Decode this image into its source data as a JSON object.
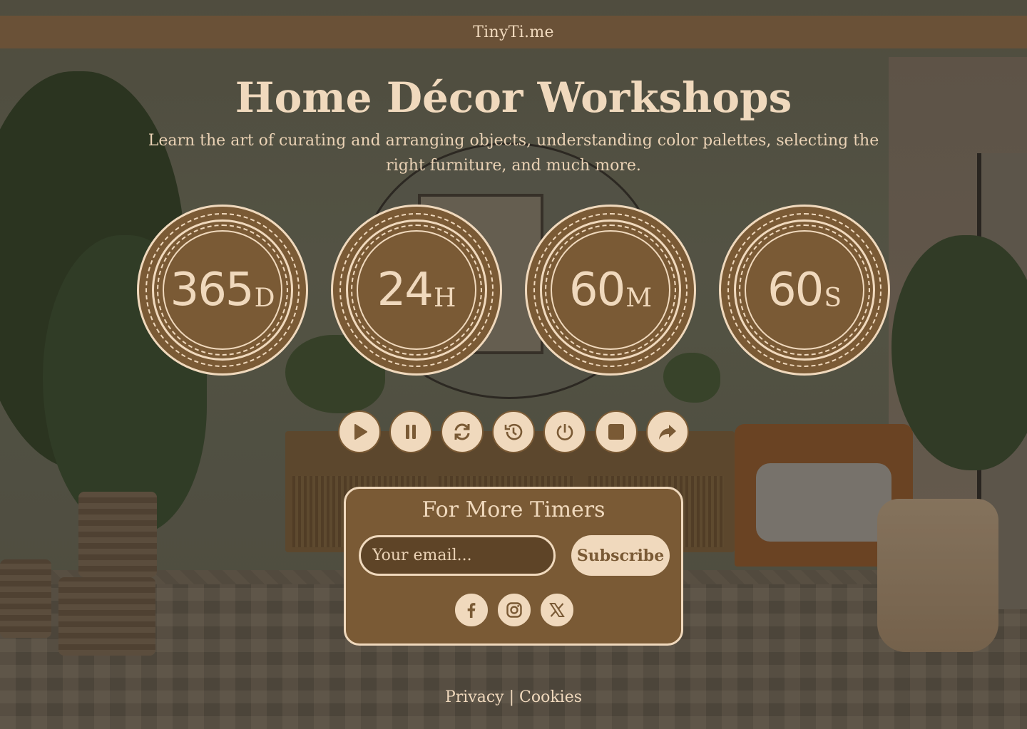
{
  "header": {
    "brand": "TinyTi.me"
  },
  "hero": {
    "title": "Home Décor Workshops",
    "subtitle": "Learn the art of curating and arranging objects, understanding color palettes, selecting the right furniture, and much more."
  },
  "timers": [
    {
      "value": "365",
      "unit": "D"
    },
    {
      "value": "24",
      "unit": "H"
    },
    {
      "value": "60",
      "unit": "M"
    },
    {
      "value": "60",
      "unit": "S"
    }
  ],
  "controls": [
    {
      "icon": "play-icon"
    },
    {
      "icon": "pause-icon"
    },
    {
      "icon": "refresh-icon"
    },
    {
      "icon": "history-icon"
    },
    {
      "icon": "power-icon"
    },
    {
      "icon": "stop-icon"
    },
    {
      "icon": "share-icon"
    }
  ],
  "subscribe": {
    "title": "For More Timers",
    "email_placeholder": "Your email...",
    "button_label": "Subscribe",
    "social": [
      "facebook-icon",
      "instagram-icon",
      "x-icon"
    ]
  },
  "footer": {
    "privacy": "Privacy",
    "separator": "|",
    "cookies": "Cookies"
  },
  "colors": {
    "accent": "#f0d9bd",
    "brown": "#7a5a35",
    "topbar": "#6e5236"
  }
}
